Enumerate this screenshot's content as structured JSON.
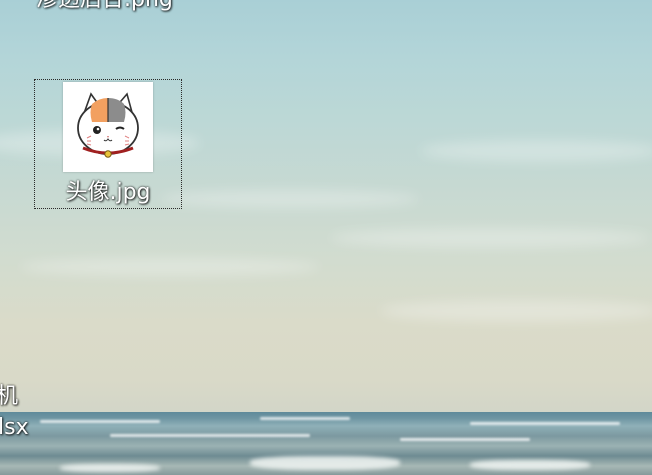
{
  "desktop": {
    "top_icon_label": "渗透后台.png",
    "selected_icon": {
      "label": "头像.jpg",
      "thumbnail_icon": "cat-avatar-icon"
    },
    "left_icon_label_1": "机",
    "left_icon_label_2": "lsx"
  },
  "colors": {
    "sky": "#b3d5d8",
    "sea": "#6d95a2",
    "label_text": "#ffffff",
    "selection_border": "#2a2a2a"
  }
}
